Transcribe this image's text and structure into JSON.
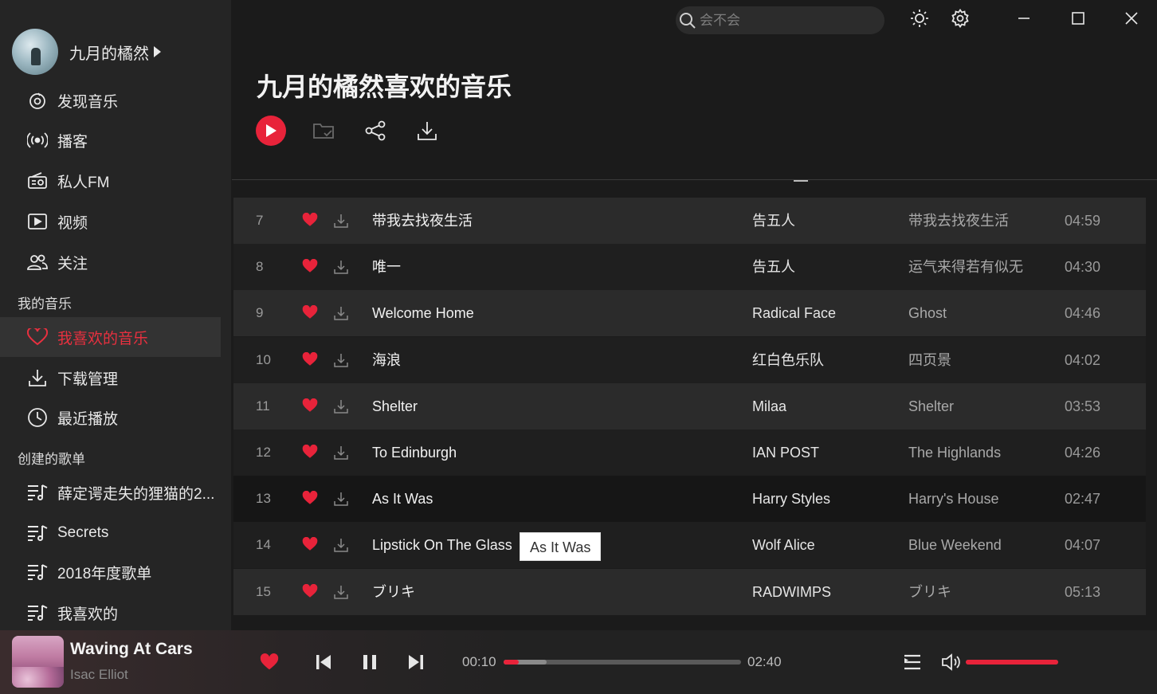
{
  "colors": {
    "accent": "#e8233a",
    "background": "#1b1b1b",
    "sidebar": "#252525"
  },
  "user": {
    "name": "九月的橘然"
  },
  "sidebar": {
    "nav": [
      {
        "label": "发现音乐",
        "icon": "discover-icon"
      },
      {
        "label": "播客",
        "icon": "podcast-icon"
      },
      {
        "label": "私人FM",
        "icon": "radio-icon"
      },
      {
        "label": "视频",
        "icon": "video-icon"
      },
      {
        "label": "关注",
        "icon": "follow-icon"
      }
    ],
    "my_music_title": "我的音乐",
    "my_music": [
      {
        "label": "我喜欢的音乐",
        "icon": "heart-icon",
        "active": true
      },
      {
        "label": "下载管理",
        "icon": "download-icon"
      },
      {
        "label": "最近播放",
        "icon": "clock-icon"
      }
    ],
    "created_title": "创建的歌单",
    "playlists": [
      {
        "label": "薛定谔走失的狸猫的2...",
        "icon": "playlist-icon"
      },
      {
        "label": "Secrets",
        "icon": "playlist-icon"
      },
      {
        "label": "2018年度歌单",
        "icon": "playlist-icon"
      },
      {
        "label": "我喜欢的",
        "icon": "playlist-icon"
      }
    ]
  },
  "search": {
    "placeholder": "会不会"
  },
  "page": {
    "title": "九月的橘然喜欢的音乐"
  },
  "tracks": [
    {
      "num": "7",
      "title": "带我去找夜生活",
      "artist": "告五人",
      "album": "带我去找夜生活",
      "duration": "04:59",
      "liked": true
    },
    {
      "num": "8",
      "title": "唯一",
      "artist": "告五人",
      "album": "运气来得若有似无",
      "duration": "04:30",
      "liked": true
    },
    {
      "num": "9",
      "title": "Welcome Home",
      "artist": "Radical Face",
      "album": "Ghost",
      "duration": "04:46",
      "liked": true
    },
    {
      "num": "10",
      "title": "海浪",
      "artist": "红白色乐队",
      "album": "四页景",
      "duration": "04:02",
      "liked": true
    },
    {
      "num": "11",
      "title": "Shelter",
      "artist": "Milaa",
      "album": "Shelter",
      "duration": "03:53",
      "liked": true
    },
    {
      "num": "12",
      "title": "To Edinburgh",
      "artist": "IAN POST",
      "album": "The Highlands",
      "duration": "04:26",
      "liked": true
    },
    {
      "num": "13",
      "title": "As It Was",
      "artist": "Harry Styles",
      "album": "Harry's House",
      "duration": "02:47",
      "liked": true
    },
    {
      "num": "14",
      "title": "Lipstick On The Glass",
      "artist": "Wolf Alice",
      "album": "Blue Weekend",
      "duration": "04:07",
      "liked": true
    },
    {
      "num": "15",
      "title": "ブリキ",
      "artist": "RADWIMPS",
      "album": "ブリキ",
      "duration": "05:13",
      "liked": true
    }
  ],
  "tooltip": {
    "text": "As It Was"
  },
  "player": {
    "title": "Waving At Cars",
    "artist": "Isac Elliot",
    "current_time": "00:10",
    "total_time": "02:40",
    "progress_fraction": 0.0625,
    "buffered_fraction": 0.18,
    "volume_fraction": 1.0,
    "liked": true
  }
}
